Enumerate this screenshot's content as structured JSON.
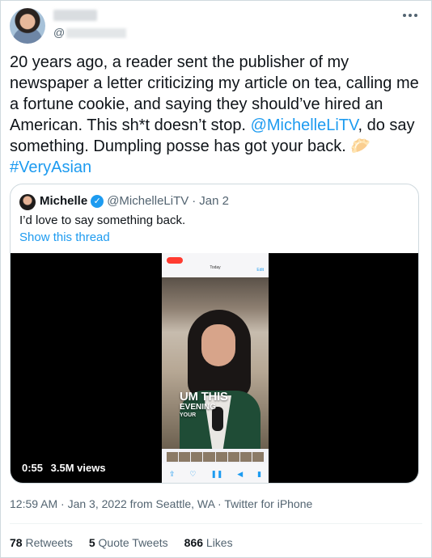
{
  "author": {
    "handle_prefix": "@",
    "avatar_icon": "profile-photo",
    "more_icon": "more-icon"
  },
  "tweet": {
    "text_part1": "20 years ago, a reader sent the publisher of my newspaper a letter criticizing my article on tea, calling me a fortune cookie, and saying they should’ve hired an American. This sh*t doesn’t stop. ",
    "mention": "@MichelleLiTV",
    "text_part2": ", do say something. Dumpling posse has got your back. ",
    "emoji": "🥟",
    "hashtag": "#VeryAsian",
    "link_color": "#1d9bf0"
  },
  "quote": {
    "name": "Michelle",
    "verified_icon": "verified-badge-icon",
    "handle": "@MichelleLiTV",
    "separator": "·",
    "date": "Jan 2",
    "text": "I’d love to say something back.",
    "show_thread": "Show this thread",
    "video": {
      "duration": "0:55",
      "views": "3.5M views",
      "phone_today": "Today",
      "phone_edit": "Edit",
      "caption_line1": "UM THIS",
      "caption_line2": "EVENING",
      "caption_line3": "YOUR"
    }
  },
  "timestamp": "12:59 AM · Jan 3, 2022 from Seattle, WA · Twitter for iPhone",
  "engagement": {
    "retweets_count": "78",
    "retweets_label": "Retweets",
    "quotes_count": "5",
    "quotes_label": "Quote Tweets",
    "likes_count": "866",
    "likes_label": "Likes"
  }
}
